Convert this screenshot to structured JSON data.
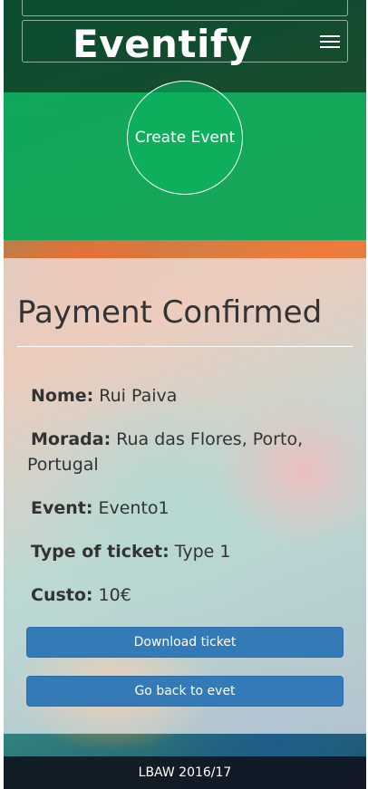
{
  "header": {
    "brand": "Eventify",
    "menu_icon": "hamburger-menu-icon"
  },
  "hero": {
    "create_event_label": "Create Event"
  },
  "main": {
    "title": "Payment Confirmed",
    "fields": [
      {
        "label": "Nome:",
        "value": "Rui Paiva"
      },
      {
        "label": "Morada:",
        "value": "Rua das Flores, Porto, Portugal"
      },
      {
        "label": "Event:",
        "value": "Evento1"
      },
      {
        "label": "Type of ticket:",
        "value": "Type 1"
      },
      {
        "label": "Custo:",
        "value": "10€"
      }
    ],
    "download_button": "Download ticket",
    "back_button": "Go back to evet"
  },
  "footer": {
    "text": "LBAW 2016/17"
  },
  "colors": {
    "nav_dark_green": "#084628",
    "hero_green": "#08aa5a",
    "button_blue": "#337ab7",
    "footer_dark": "#0f141e"
  }
}
